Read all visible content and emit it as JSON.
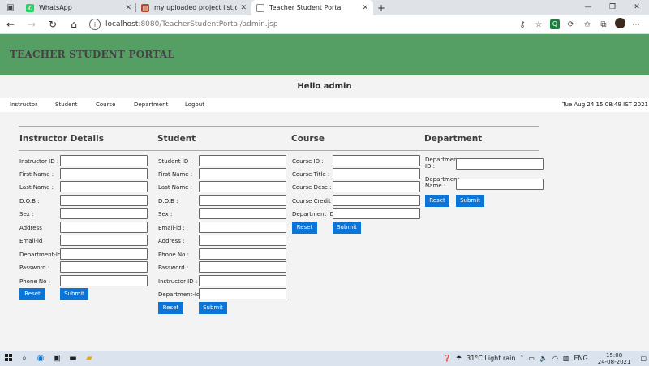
{
  "browser": {
    "tabs": [
      {
        "title": "WhatsApp",
        "favicon": "whatsapp-icon",
        "color": "#25d366"
      },
      {
        "title": "my uploaded project list.downlo",
        "favicon": "document-icon",
        "color": "#b04a2e"
      },
      {
        "title": "Teacher Student Portal",
        "favicon": "page-icon",
        "color": "#888888",
        "active": true
      }
    ],
    "new_tab": "+",
    "url_host": "localhost",
    "url_path": ":8080/TeacherStudentPortal/admin.jsp"
  },
  "page": {
    "banner_title": "TEACHER STUDENT PORTAL",
    "banner_color": "#569f64",
    "greeting": "Hello admin",
    "menu": [
      "Instructor",
      "Student",
      "Course",
      "Department",
      "Logout"
    ],
    "datetime": "Tue Aug 24 15:08:49 IST 2021"
  },
  "sections": {
    "instructor": {
      "title": "Instructor Details",
      "fields": [
        "Instructor ID :",
        "First Name :",
        "Last Name :",
        "D.O.B :",
        "Sex :",
        "Address :",
        "Email-id :",
        "Department-Id:",
        "Password :",
        "Phone No :"
      ]
    },
    "student": {
      "title": "Student",
      "fields": [
        "Student ID :",
        "First Name :",
        "Last Name :",
        "D.O.B :",
        "Sex :",
        "Email-id :",
        "Address :",
        "Phone No :",
        "Password :",
        "Instructor ID :",
        "Department-Id:"
      ]
    },
    "course": {
      "title": "Course",
      "fields": [
        "Course ID :",
        "Course Title :",
        "Course Desc :",
        "Course Credit :",
        "Department ID:"
      ]
    },
    "department": {
      "title": "Department",
      "fields": [
        "Department ID :",
        "Department Name :"
      ]
    },
    "buttons": {
      "reset": "Reset",
      "submit": "Submit"
    },
    "button_color": "#0b74d8"
  },
  "taskbar": {
    "weather": "31°C  Light rain",
    "language": "ENG",
    "time": "15:08",
    "date": "24-08-2021"
  }
}
